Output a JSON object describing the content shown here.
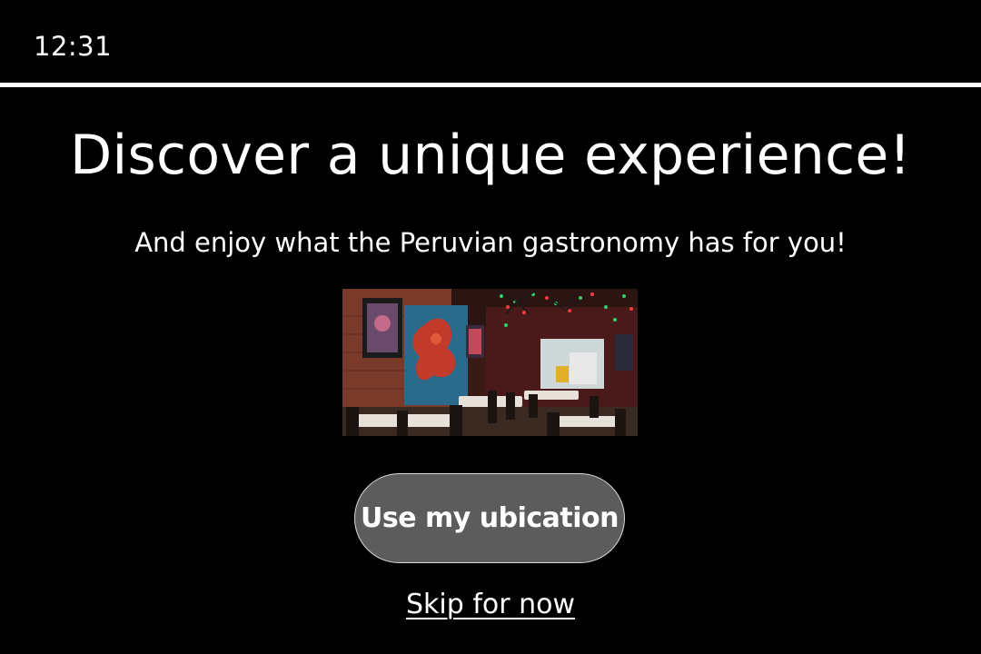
{
  "status_bar": {
    "time": "12:31"
  },
  "onboarding": {
    "title": "Discover a unique experience!",
    "subtitle": "And enjoy what the Peruvian gastronomy has for you!",
    "image_subject": "restaurant-interior-photo",
    "primary_button_label": "Use my ubication",
    "skip_link_label": "Skip for now"
  },
  "colors": {
    "background": "#000000",
    "text": "#ffffff",
    "button_fill": "#5c5c5c",
    "button_border": "#d9d9d9"
  }
}
